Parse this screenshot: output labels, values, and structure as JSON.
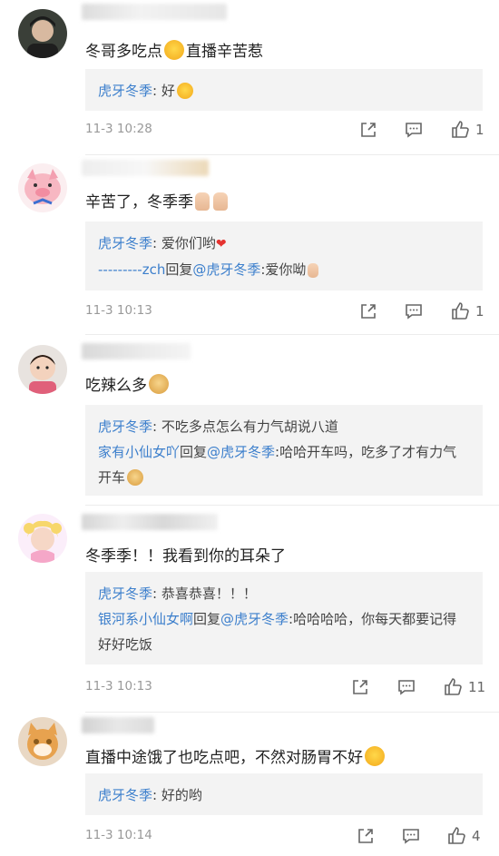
{
  "comments": [
    {
      "text_a": "冬哥多吃点",
      "text_b": "直播辛苦惹",
      "replies": [
        {
          "who": "虎牙冬季",
          "text": ": 好"
        }
      ],
      "time": "11-3 10:28",
      "likes": "1"
    },
    {
      "text_a": "辛苦了，冬季季",
      "replies": [
        {
          "who": "虎牙冬季",
          "text": ": 爱你们哟"
        },
        {
          "who": "---------zch",
          "mid": "回复",
          "at": "@虎牙冬季",
          "text": ":爱你呦"
        }
      ],
      "time": "11-3 10:13",
      "likes": "1"
    },
    {
      "text_a": "吃辣么多",
      "replies": [
        {
          "who": "虎牙冬季",
          "text": ": 不吃多点怎么有力气胡说八道"
        },
        {
          "who": "家有小仙女吖",
          "mid": "回复",
          "at": "@虎牙冬季",
          "text": ":哈哈开车吗，吃多了才有力气开车"
        }
      ],
      "time": "",
      "likes": ""
    },
    {
      "text_a": "冬季季！！我看到你的耳朵了",
      "replies": [
        {
          "who": "虎牙冬季",
          "text": ": 恭喜恭喜！！！"
        },
        {
          "who": "银河系小仙女啊",
          "mid": "回复",
          "at": "@虎牙冬季",
          "text": ":哈哈哈哈，你每天都要记得好好吃饭"
        }
      ],
      "time": "11-3 10:13",
      "likes": "11"
    },
    {
      "text_a": "直播中途饿了也吃点吧，不然对肠胃不好",
      "replies": [
        {
          "who": "虎牙冬季",
          "text": ": 好的哟"
        }
      ],
      "time": "11-3 10:14",
      "likes": "4"
    }
  ],
  "icons": {
    "share": "share-icon",
    "comment": "comment-icon",
    "like": "thumbs-up-icon"
  },
  "colors": {
    "link": "#3c7fcc",
    "reply_bg": "#f3f3f3",
    "meta": "#999999"
  }
}
